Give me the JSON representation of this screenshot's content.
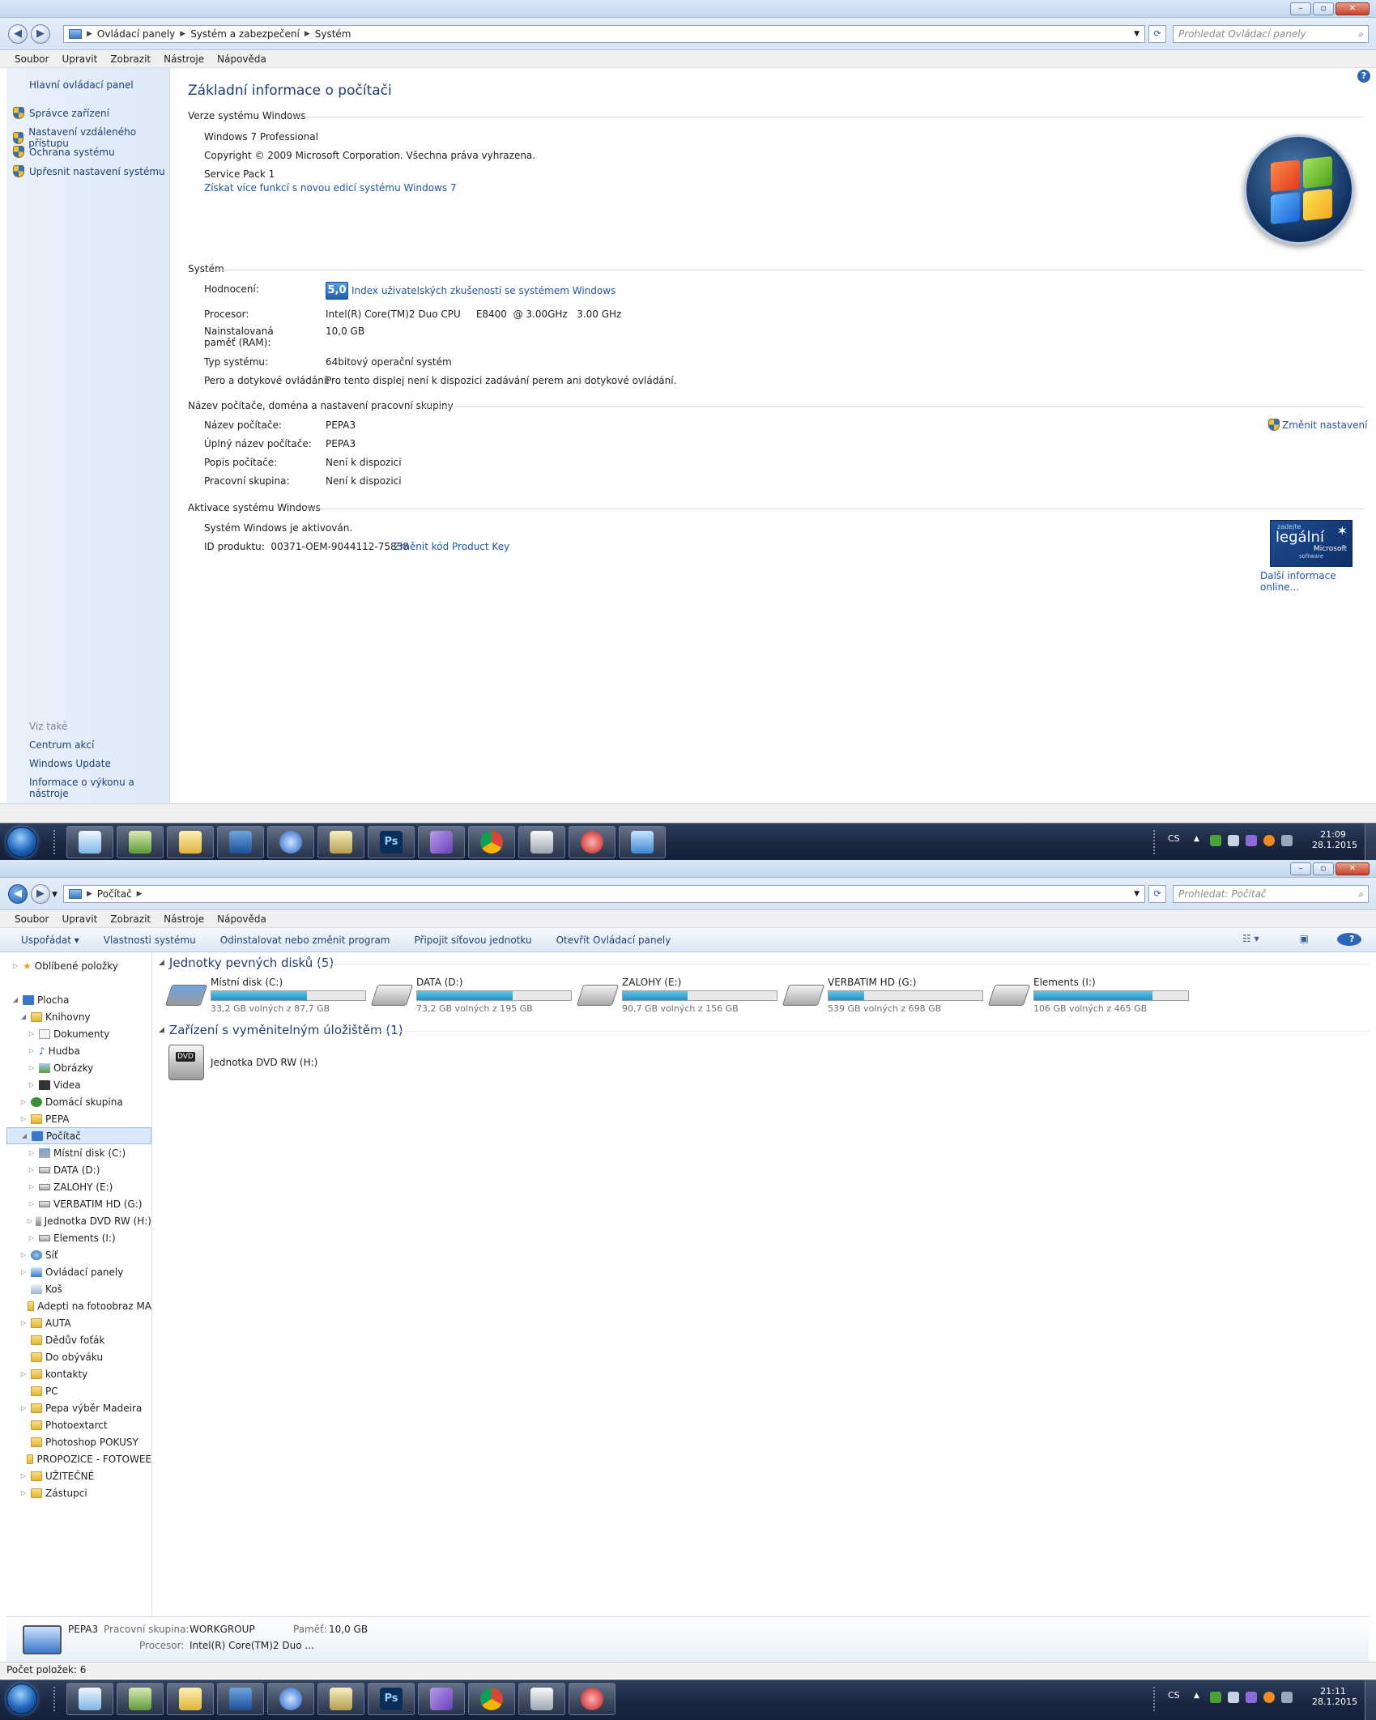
{
  "win1": {
    "breadcrumb": [
      "Ovládací panely",
      "Systém a zabezpečení",
      "Systém"
    ],
    "search_placeholder": "Prohledat Ovládací panely",
    "menu": [
      "Soubor",
      "Upravit",
      "Zobrazit",
      "Nástroje",
      "Nápověda"
    ],
    "left": {
      "home": "Hlavní ovládací panel",
      "tasks": [
        "Správce zařízení",
        "Nastavení vzdáleného přístupu",
        "Ochrana systému",
        "Upřesnit nastavení systému"
      ],
      "see_also": "Viz také",
      "see_links": [
        "Centrum akcí",
        "Windows Update",
        "Informace o výkonu a nástroje"
      ]
    },
    "title": "Základní informace o počítači",
    "edition": {
      "header": "Verze systému Windows",
      "name": "Windows 7 Professional",
      "copyright": "Copyright © 2009 Microsoft Corporation. Všechna práva vyhrazena.",
      "sp": "Service Pack 1",
      "link": "Získat více funkcí s novou edicí systému Windows 7"
    },
    "system": {
      "header": "Systém",
      "rows": [
        {
          "label": "Hodnocení:",
          "value": ""
        },
        {
          "label": "Procesor:",
          "value": "Intel(R) Core(TM)2 Duo CPU     E8400  @ 3.00GHz   3.00 GHz"
        },
        {
          "label": "Nainstalovaná paměť (RAM):",
          "value": "10,0 GB"
        },
        {
          "label": "Typ systému:",
          "value": "64bitový operační systém"
        },
        {
          "label": "Pero a dotykové ovládání:",
          "value": "Pro tento displej není k dispozici zadávání perem ani dotykové ovládání."
        }
      ],
      "score": "5,0",
      "wei_link": "Index uživatelských zkušeností se systémem Windows"
    },
    "name": {
      "header": "Název počítače, doména a nastavení pracovní skupiny",
      "rows": [
        {
          "label": "Název počítače:",
          "value": "PEPA3"
        },
        {
          "label": "Úplný název počítače:",
          "value": "PEPA3"
        },
        {
          "label": "Popis počítače:",
          "value": "Není k dispozici"
        },
        {
          "label": "Pracovní skupina:",
          "value": "Není k dispozici"
        }
      ],
      "change": "Změnit nastavení"
    },
    "activation": {
      "header": "Aktivace systému Windows",
      "status": "Systém Windows je aktivován.",
      "pid": "ID produktu:  00371-OEM-9044112-75838",
      "change_key": "Změnit kód Product Key",
      "badge": {
        "top": "zadejte",
        "main": "legální",
        "brand": "Microsoft",
        "sub": "software"
      },
      "more": "Další informace online..."
    }
  },
  "taskbar1": {
    "lang": "CS",
    "time": "21:09",
    "date": "28.1.2015"
  },
  "win2": {
    "breadcrumb": [
      "Počítač"
    ],
    "search_placeholder": "Prohledat: Počítač",
    "menu": [
      "Soubor",
      "Upravit",
      "Zobrazit",
      "Nástroje",
      "Nápověda"
    ],
    "commands": [
      "Uspořádat ▾",
      "Vlastnosti systému",
      "Odinstalovat nebo změnit program",
      "Připojit síťovou jednotku",
      "Otevřít Ovládací panely"
    ],
    "tree": [
      {
        "label": "Oblíbené položky",
        "indent": 0
      },
      {
        "label": "Plocha",
        "indent": 0
      },
      {
        "label": "Knihovny",
        "indent": 1
      },
      {
        "label": "Dokumenty",
        "indent": 2
      },
      {
        "label": "Hudba",
        "indent": 2
      },
      {
        "label": "Obrázky",
        "indent": 2
      },
      {
        "label": "Videa",
        "indent": 2
      },
      {
        "label": "Domácí skupina",
        "indent": 1
      },
      {
        "label": "PEPA",
        "indent": 1
      },
      {
        "label": "Počítač",
        "indent": 1
      },
      {
        "label": "Místní disk (C:)",
        "indent": 2
      },
      {
        "label": "DATA (D:)",
        "indent": 2
      },
      {
        "label": "ZALOHY (E:)",
        "indent": 2
      },
      {
        "label": "VERBATIM HD (G:)",
        "indent": 2
      },
      {
        "label": "Jednotka DVD RW (H:)",
        "indent": 2
      },
      {
        "label": "Elements (I:)",
        "indent": 2
      },
      {
        "label": "Síť",
        "indent": 1
      },
      {
        "label": "Ovládací panely",
        "indent": 1
      },
      {
        "label": "Koš",
        "indent": 1
      },
      {
        "label": "Adepti na fotoobraz MA",
        "indent": 1
      },
      {
        "label": "AUTA",
        "indent": 1
      },
      {
        "label": "Dědův foťák",
        "indent": 1
      },
      {
        "label": "Do obýváku",
        "indent": 1
      },
      {
        "label": "kontakty",
        "indent": 1
      },
      {
        "label": "PC",
        "indent": 1
      },
      {
        "label": "Pepa výběr Madeira",
        "indent": 1
      },
      {
        "label": "Photoextarct",
        "indent": 1
      },
      {
        "label": "Photoshop POKUSY",
        "indent": 1
      },
      {
        "label": "PROPOZICE - FOTOWEE",
        "indent": 1
      },
      {
        "label": "UŽITEČNÉ",
        "indent": 1
      },
      {
        "label": "Zástupci",
        "indent": 1
      }
    ],
    "hdd_header": "Jednotky pevných disků (5)",
    "drives": [
      {
        "name": "Místní disk (C:)",
        "free": "33,2 GB volných z 87,7 GB",
        "used": 0.62
      },
      {
        "name": "DATA (D:)",
        "free": "73,2 GB volných z 195 GB",
        "used": 0.62
      },
      {
        "name": "ZALOHY (E:)",
        "free": "90,7 GB volných z 156 GB",
        "used": 0.42
      },
      {
        "name": "VERBATIM HD (G:)",
        "free": "539 GB volných z 698 GB",
        "used": 0.23
      },
      {
        "name": "Elements (I:)",
        "free": "106 GB volných z 465 GB",
        "used": 0.77
      }
    ],
    "rem_header": "Zařízení s vyměnitelným úložištěm (1)",
    "dvd": "Jednotka DVD RW (H:)",
    "dvd_badge": "DVD",
    "details": {
      "name": "PEPA3",
      "wg_label": "Pracovní skupina:",
      "wg": "WORKGROUP",
      "mem_label": "Paměť:",
      "mem": "10,0 GB",
      "cpu_label": "Procesor:",
      "cpu": "Intel(R) Core(TM)2 Duo ..."
    },
    "status": "Počet položek: 6"
  },
  "taskbar2": {
    "lang": "CS",
    "time": "21:11",
    "date": "28.1.2015"
  },
  "colors": {
    "link": "#1e57a6",
    "accent": "#1e3f73"
  }
}
